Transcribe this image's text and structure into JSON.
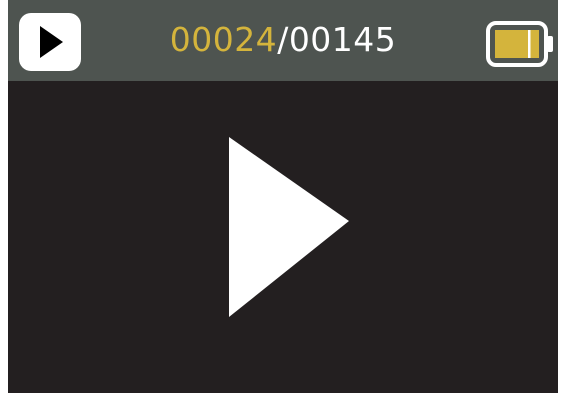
{
  "status_bar": {
    "mode_icon": "play-icon",
    "counter": {
      "current": "00024",
      "separator": "/",
      "total": "00145"
    },
    "battery_icon": "battery-icon",
    "battery_level": 1.0
  },
  "main": {
    "center_icon": "play-icon"
  },
  "colors": {
    "status_bar_bg": "#4e5450",
    "screen_bg": "#231f20",
    "accent": "#d4b43c",
    "foreground": "#ffffff"
  }
}
